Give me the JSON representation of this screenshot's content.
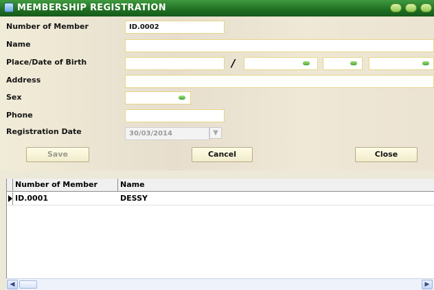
{
  "window": {
    "title": "MEMBERSHIP REGISTRATION",
    "icon": "form-icon",
    "controls": [
      "minimize-icon",
      "maximize-icon",
      "close-icon"
    ]
  },
  "form": {
    "member_number_label": "Number of Member",
    "member_number_value": "ID.0002",
    "name_label": "Name",
    "name_value": "",
    "birth_label": "Place/Date of Birth",
    "birth_place_value": "",
    "birth_separator": "/",
    "birth_day_value": "",
    "birth_month_value": "",
    "birth_year_value": "",
    "address_label": "Address",
    "address_value": "",
    "sex_label": "Sex",
    "sex_value": "",
    "phone_label": "Phone",
    "phone_value": "",
    "reg_date_label": "Registration Date",
    "reg_date_value": "30/03/2014"
  },
  "buttons": {
    "save": "Save",
    "cancel": "Cancel",
    "close": "Close"
  },
  "grid": {
    "columns": [
      "Number of Member",
      "Name"
    ],
    "rows": [
      {
        "member": "ID.0001",
        "name": "DESSY"
      }
    ]
  },
  "colors": {
    "title_bar": "#1f6e22",
    "field_border": "#e6d685",
    "dropdown_arrow": "#44a53c"
  }
}
